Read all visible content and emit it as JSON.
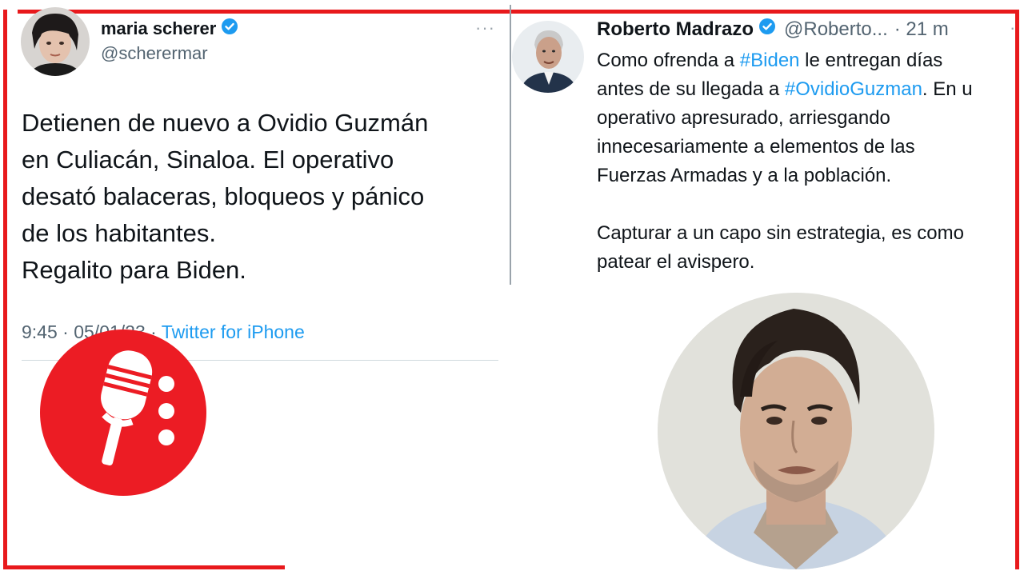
{
  "left_tweet": {
    "display_name": "maria scherer",
    "handle": "@scherermar",
    "more_label": "···",
    "text": "Detienen de nuevo a Ovidio Guzmán\nen Culiacán, Sinaloa. El operativo\ndesató balaceras, bloqueos y pánico\nde los habitantes.\nRegalito para Biden.",
    "time": "9:45",
    "date": "05/01/23",
    "separator": "·",
    "source": "Twitter for iPhone"
  },
  "right_tweet": {
    "display_name": "Roberto Madrazo",
    "handle": "@Roberto...",
    "age": "· 21 m",
    "more_label": "·",
    "text_lines": [
      [
        "Como ofrenda a ",
        "#Biden",
        " le entregan días"
      ],
      [
        "antes de su llegada a ",
        "#OvidioGuzman",
        ". En u"
      ],
      [
        "operativo apresurado, arriesgando",
        "",
        ""
      ],
      [
        "innecesariamente a elementos de las",
        "",
        ""
      ],
      [
        "Fuerzas Armadas y a la población.",
        "",
        ""
      ],
      [
        "",
        "",
        ""
      ],
      [
        "Capturar a un capo sin estrategia, es como",
        "",
        ""
      ],
      [
        "patear el avispero.",
        "",
        ""
      ]
    ]
  },
  "colors": {
    "frame_red": "#e8191c",
    "link_blue": "#1d9bf0",
    "verified_blue": "#1d9bf0",
    "secondary_text": "#536471"
  },
  "icons": {
    "verified": "verified-badge-icon",
    "microphone": "microphone-icon"
  }
}
